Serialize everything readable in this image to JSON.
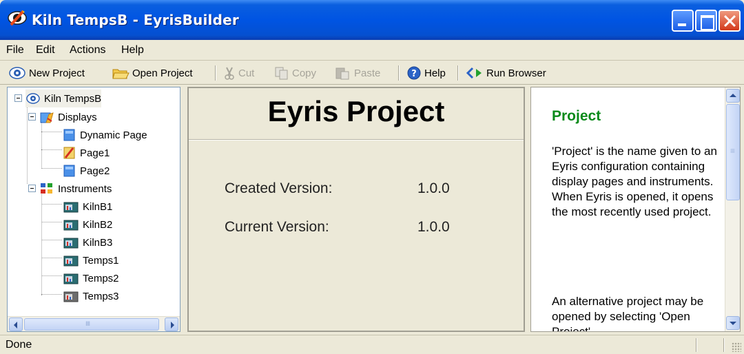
{
  "window": {
    "title": "Kiln TempsB - EyrisBuilder"
  },
  "menubar": {
    "items": [
      "File",
      "Edit",
      "Actions",
      "Help"
    ]
  },
  "toolbar": {
    "new_project": "New Project",
    "open_project": "Open Project",
    "cut": "Cut",
    "copy": "Copy",
    "paste": "Paste",
    "help": "Help",
    "run_browser": "Run Browser"
  },
  "tree": {
    "root": "Kiln TempsB",
    "displays": {
      "label": "Displays",
      "children": [
        "Dynamic Page",
        "Page1",
        "Page2"
      ]
    },
    "instruments": {
      "label": "Instruments",
      "children": [
        "KilnB1",
        "KilnB2",
        "KilnB3",
        "Temps1",
        "Temps2",
        "Temps3"
      ]
    }
  },
  "center": {
    "title": "Eyris Project",
    "created_label": "Created Version:",
    "created_value": "1.0.0",
    "current_label": "Current Version:",
    "current_value": "1.0.0"
  },
  "help_pane": {
    "title": "Project",
    "paragraph1": "'Project' is the name given to an Eyris configuration containing display pages and instruments.  When Eyris is opened, it opens the most recently used project.",
    "paragraph2": "An alternative project may be opened by selecting 'Open Project'"
  },
  "status": {
    "text": "Done"
  },
  "colors": {
    "titlebar": "#0054e3",
    "help_title": "#0a8a1a"
  }
}
